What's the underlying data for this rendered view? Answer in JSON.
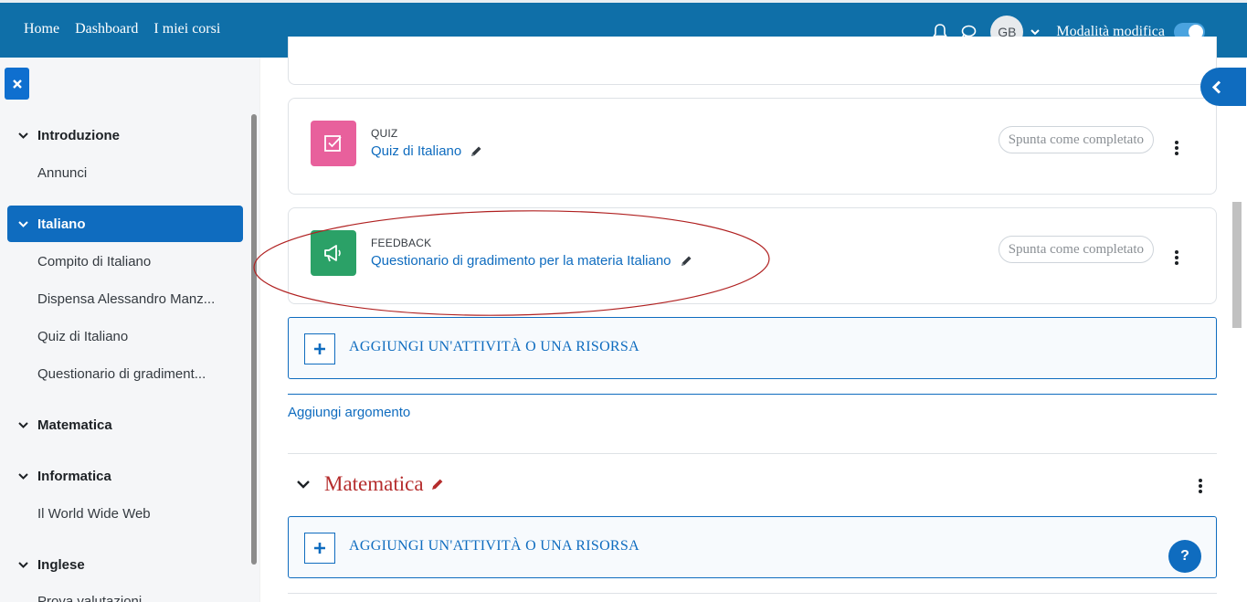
{
  "nav": {
    "links": [
      "Home",
      "Dashboard",
      "I miei corsi"
    ],
    "avatar_initials": "GB",
    "edit_mode_label": "Modalità modifica",
    "edit_mode_on": true
  },
  "drawer": {
    "sections": [
      {
        "label": "Introduzione",
        "items": [
          "Annunci"
        ]
      },
      {
        "label": "Italiano",
        "active": true,
        "items": [
          "Compito di Italiano",
          "Dispensa Alessandro Manz...",
          "Quiz di Italiano",
          "Questionario di gradiment..."
        ]
      },
      {
        "label": "Matematica",
        "items": []
      },
      {
        "label": "Informatica",
        "items": [
          "Il World Wide Web"
        ]
      },
      {
        "label": "Inglese",
        "items": [
          "Prova valutazioni"
        ]
      }
    ]
  },
  "activities": [
    {
      "type": "QUIZ",
      "name": "Quiz di Italiano",
      "completion": "Spunta come completato",
      "color": "#e8609c"
    },
    {
      "type": "FEEDBACK",
      "name": "Questionario di gradimento per la materia Italiano",
      "completion": "Spunta come completato",
      "color": "#2ba167"
    }
  ],
  "add_activity_label": "AGGIUNGI UN'ATTIVITÀ O UNA RISORSA",
  "add_topic_label": "Aggiungi argomento",
  "next_section": {
    "title": "Matematica",
    "add_activity_label": "AGGIUNGI UN'ATTIVITÀ O UNA RISORSA"
  },
  "help_label": "?",
  "colors": {
    "navbar": "#0f6fa8",
    "link": "#0f6cbf",
    "section_title": "#b52d2d",
    "annotation": "#b02020"
  }
}
